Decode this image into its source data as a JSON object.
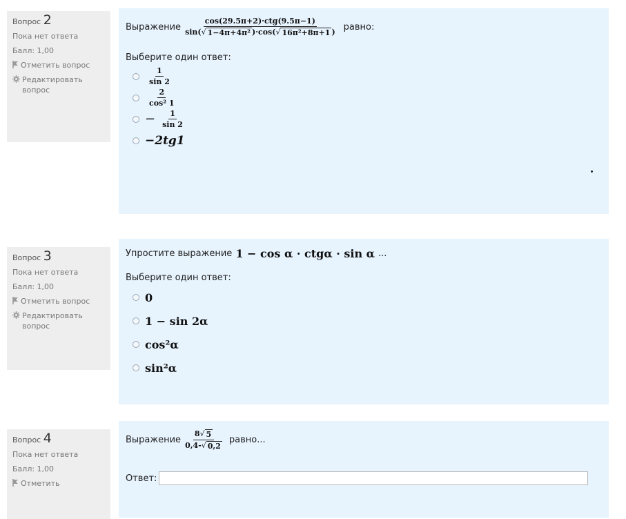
{
  "questions": [
    {
      "label": "Вопрос",
      "number": "2",
      "status": "Пока нет ответа",
      "grade": "Балл: 1,00",
      "flag": "Отметить вопрос",
      "edit": "Редактировать вопрос",
      "prefix": "Выражение",
      "suffix": "равно:",
      "formula": {
        "num": "cos(29.5π+2)·ctg(9.5π−1)",
        "den_a": "sin(",
        "den_a_sqrt": "1−4π+4π²",
        "den_b": ")·cos(",
        "den_b_sqrt": "16π²+8π+1",
        "den_c": ")"
      },
      "prompt": "Выберите один ответ:",
      "options": [
        {
          "num": "1",
          "den": "sin 2"
        },
        {
          "num": "2",
          "den": "cos² 1"
        },
        {
          "sign": "−",
          "num": "1",
          "den": "sin 2"
        },
        {
          "text": "−2tg1"
        }
      ]
    },
    {
      "label": "Вопрос",
      "number": "3",
      "status": "Пока нет ответа",
      "grade": "Балл: 1,00",
      "flag": "Отметить вопрос",
      "edit": "Редактировать вопрос",
      "prefix": "Упростите выражение",
      "formula": "1 − cos α · ctgα · sin α",
      "suffix": "...",
      "prompt": "Выберите один ответ:",
      "options": [
        {
          "text": "0"
        },
        {
          "text": "1 − sin 2α"
        },
        {
          "text": "cos²α"
        },
        {
          "text": "sin²α"
        }
      ]
    },
    {
      "label": "Вопрос",
      "number": "4",
      "status": "Пока нет ответа",
      "grade": "Балл: 1,00",
      "flag": "Отметить",
      "prefix": "Выражение",
      "formula": {
        "num_coef": "8",
        "num_sqrt": "5",
        "den_a": "0,4-",
        "den_sqrt": "0,2"
      },
      "suffix": "равно...",
      "answer_label": "Ответ:",
      "answer_value": ""
    }
  ]
}
